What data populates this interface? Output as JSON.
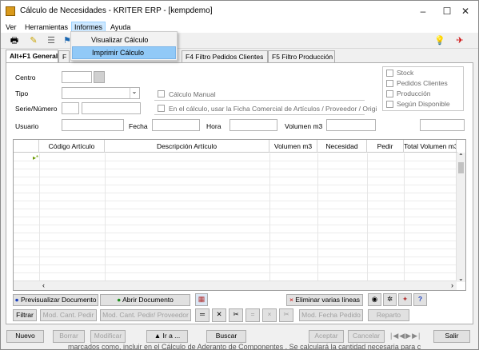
{
  "window": {
    "title": "Cálculo de Necesidades - KRITER ERP - [kempdemo]",
    "controls": [
      "–",
      "☐",
      "✕"
    ]
  },
  "menubar": [
    "Ver",
    "Herramientas",
    "Informes",
    "Ayuda"
  ],
  "dropdown": [
    "Visualizar Cálculo",
    "Imprimir Cálculo"
  ],
  "tabs": [
    "Alt+F1 General",
    "F",
    "F4 Filtro Pedidos Clientes",
    "F5 Filtro Producción"
  ],
  "form": {
    "centro": "Centro",
    "tipo": "Tipo",
    "serie": "Serie/Número",
    "usuario": "Usuario",
    "fecha": "Fecha",
    "hora": "Hora",
    "volumen": "Volumen m3",
    "calculo_manual": "Cálculo Manual",
    "ficha": "En el cálculo, usar la Ficha Comercial de Artículos / Proveedor / Origi",
    "options": [
      "Stock",
      "Pedidos Clientes",
      "Producción",
      "Según Disponible"
    ]
  },
  "grid": {
    "columns": [
      "Código Artículo",
      "Descripción Artículo",
      "Volumen m3",
      "Necesidad",
      "Pedir",
      "Total Volumen m3"
    ]
  },
  "row_buttons": {
    "previsualizar": "Previsualizar Documento",
    "abrir": "Abrir Documento",
    "eliminar": "Eliminar varias líneas"
  },
  "filter_buttons": {
    "filtrar": "Filtrar",
    "mod_cant_pedir": "Mod. Cant. Pedir",
    "mod_cant_pedir_prov": "Mod. Cant. Pedir/ Proveedor",
    "mod_fecha_pedido": "Mod. Fecha Pedido",
    "reparto": "Reparto"
  },
  "footer": {
    "nuevo": "Nuevo",
    "borrar": "Borrar",
    "modificar": "Modificar",
    "ira": "Ir a ...",
    "buscar": "Buscar",
    "aceptar": "Aceptar",
    "cancelar": "Cancelar",
    "salir": "Salir"
  },
  "behind_text": "marcados como, incluir en el Cálculo de Aderanto de Componentes . Se calculará la cantidad necesaria para c"
}
